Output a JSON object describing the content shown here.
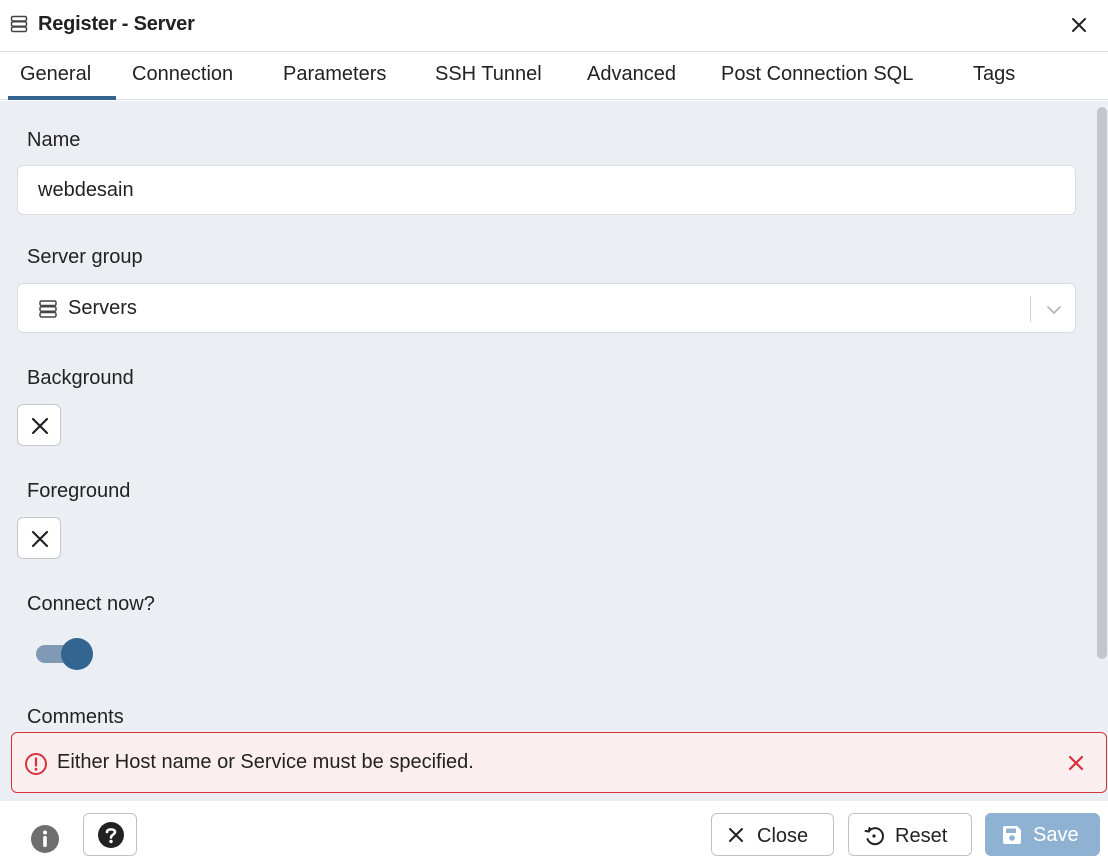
{
  "dialog": {
    "title": "Register - Server",
    "icon": "server-icon",
    "close_icon": "close-icon"
  },
  "tabs": [
    {
      "label": "General",
      "active": true
    },
    {
      "label": "Connection"
    },
    {
      "label": "Parameters"
    },
    {
      "label": "SSH Tunnel"
    },
    {
      "label": "Advanced"
    },
    {
      "label": "Post Connection SQL"
    },
    {
      "label": "Tags"
    }
  ],
  "form": {
    "name_label": "Name",
    "name_value": "webdesain",
    "server_group_label": "Server group",
    "server_group_value": "Servers",
    "background_label": "Background",
    "foreground_label": "Foreground",
    "connect_now_label": "Connect now?",
    "connect_now": true,
    "comments_label": "Comments"
  },
  "alert": {
    "message": "Either Host name or Service must be specified.",
    "icon": "error-circle-icon",
    "close_icon": "close-icon"
  },
  "footer": {
    "info_icon": "info-icon",
    "help_icon": "help-icon",
    "close_label": "Close",
    "reset_label": "Reset",
    "save_label": "Save"
  },
  "colors": {
    "accent": "#326690",
    "alert_border": "#d8323b",
    "alert_bg": "#fbeeee",
    "save_disabled": "#8fb2d3",
    "panel_bg": "#ebeef3"
  }
}
